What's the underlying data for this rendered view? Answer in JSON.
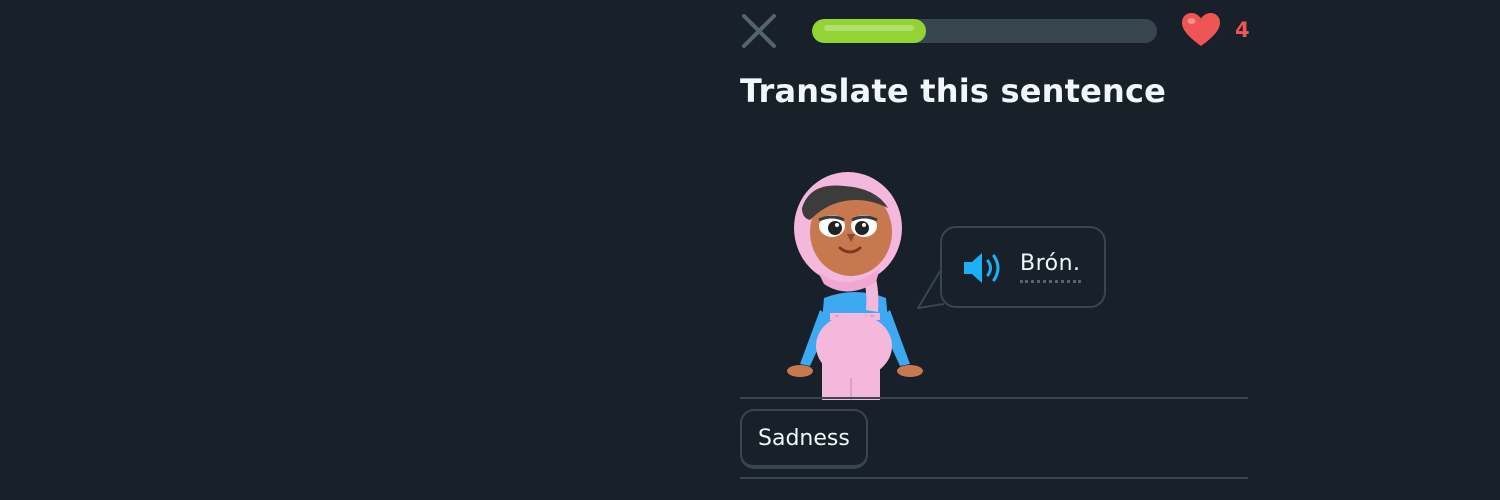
{
  "header": {
    "close_icon": "close-icon",
    "progress_fraction": 0.33,
    "progress_color": "#93d333",
    "heart_icon": "heart-icon",
    "hearts_count": "4",
    "heart_color": "#ee5555"
  },
  "prompt": {
    "title": "Translate this sentence"
  },
  "bubble": {
    "speaker_icon": "speaker-icon",
    "text": "Brón."
  },
  "word_bank": {
    "selected_words": [
      "Sadness"
    ]
  },
  "colors": {
    "background": "#18202a",
    "border": "#37464f",
    "text": "#f1f7fb",
    "speaker": "#1cb0f6"
  }
}
